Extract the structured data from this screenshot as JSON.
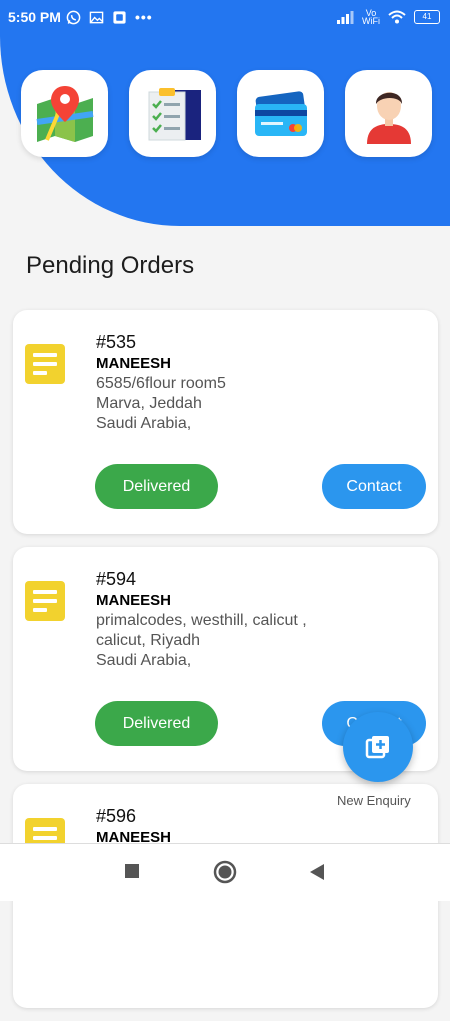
{
  "status_bar": {
    "time": "5:50 PM",
    "left_icons": [
      "whatsapp-icon",
      "gallery-icon",
      "app-icon"
    ],
    "overflow": "•••",
    "network_label_top": "Vo",
    "network_label_bottom": "WiFi",
    "battery": "41"
  },
  "quick_actions": [
    {
      "name": "map-icon"
    },
    {
      "name": "checklist-icon"
    },
    {
      "name": "credit-card-icon"
    },
    {
      "name": "profile-icon"
    }
  ],
  "section_title": "Pending Orders",
  "orders": [
    {
      "id": "#535",
      "name": "MANEESH",
      "address": [
        "6585/6flour room5",
        "Marva, Jeddah",
        "Saudi Arabia,"
      ],
      "status_button": "Delivered",
      "contact_button": "Contact"
    },
    {
      "id": "#594",
      "name": "MANEESH",
      "address": [
        "primalcodes, westhill, calicut ,",
        "calicut, Riyadh",
        "Saudi Arabia,"
      ],
      "status_button": "Delivered",
      "contact_button": "Contact"
    },
    {
      "id": "#596",
      "name": "MANEESH",
      "address": [],
      "status_button": "",
      "contact_button": ""
    }
  ],
  "fab": {
    "label": "New Enquiry"
  },
  "nav_bar": [
    "recent-apps-icon",
    "home-icon",
    "back-icon"
  ],
  "colors": {
    "header": "#2376f0",
    "delivered": "#3ba84a",
    "contact": "#2b96ee",
    "order_icon": "#f2d22e"
  }
}
